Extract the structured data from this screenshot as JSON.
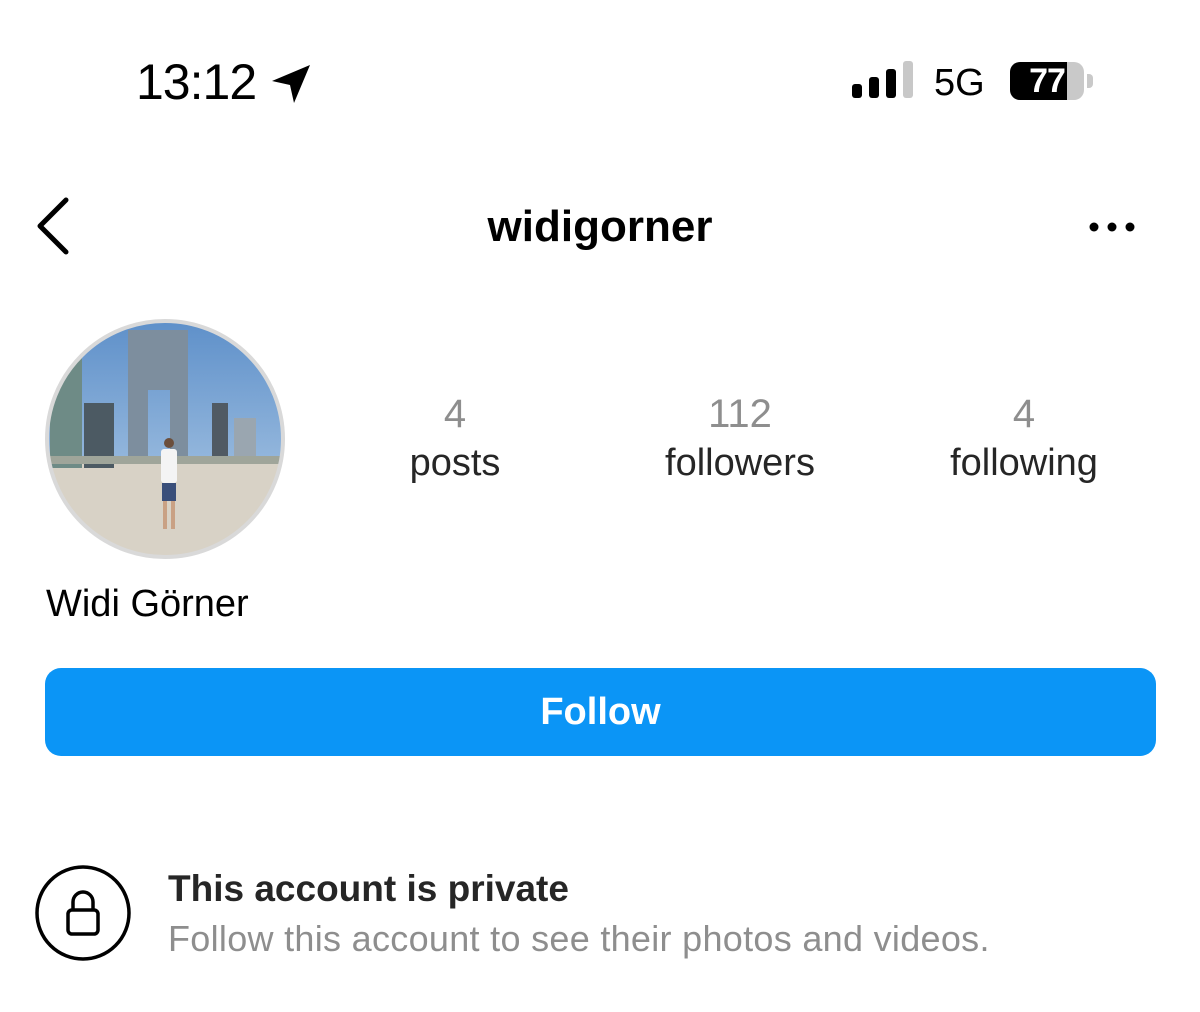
{
  "status_bar": {
    "time": "13:12",
    "location_icon": "location-arrow-icon",
    "signal_icon": "cellular-signal-icon",
    "signal_bars": 3,
    "signal_bars_total": 4,
    "network": "5G",
    "battery_level": "77",
    "battery_fraction": 0.77
  },
  "nav": {
    "back_icon": "chevron-left-icon",
    "username": "widigorner",
    "more_icon": "more-horizontal-icon"
  },
  "profile": {
    "avatar_icon": "profile-avatar",
    "full_name": "Widi Görner",
    "stats": [
      {
        "value": "4",
        "label": "posts"
      },
      {
        "value": "112",
        "label": "followers"
      },
      {
        "value": "4",
        "label": "following"
      }
    ],
    "follow_label": "Follow",
    "follow_color": "#0b95f6"
  },
  "private_notice": {
    "icon": "lock-icon",
    "title": "This account is private",
    "subtitle": "Follow this account to see their photos and videos."
  }
}
